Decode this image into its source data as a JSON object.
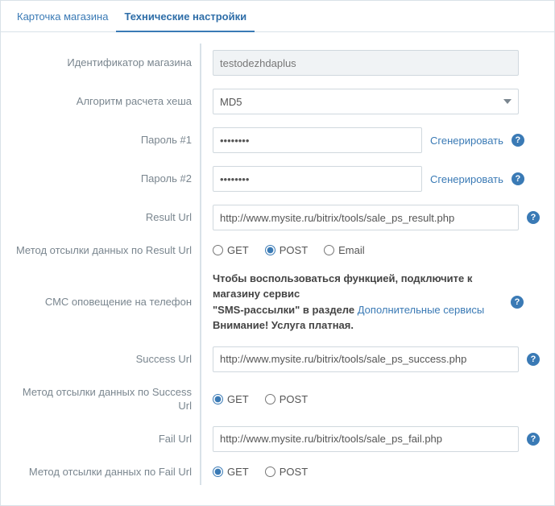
{
  "tabs": {
    "card": "Карточка магазина",
    "tech": "Технические настройки"
  },
  "labels": {
    "shop_id": "Идентификатор магазина",
    "hash_algo": "Алгоритм расчета хеша",
    "pass1": "Пароль #1",
    "pass2": "Пароль #2",
    "result_url": "Result Url",
    "result_method": "Метод отсылки данных по Result Url",
    "sms": "СМС оповещение на телефон",
    "success_url": "Success Url",
    "success_method": "Метод отсылки данных по Success Url",
    "fail_url": "Fail Url",
    "fail_method": "Метод отсылки данных по Fail Url"
  },
  "values": {
    "shop_id": "testodezhdaplus",
    "hash_algo": "MD5",
    "pass1": "••••••••",
    "pass2": "••••••••",
    "result_url": "http://www.mysite.ru/bitrix/tools/sale_ps_result.php",
    "success_url": "http://www.mysite.ru/bitrix/tools/sale_ps_success.php",
    "fail_url": "http://www.mysite.ru/bitrix/tools/sale_ps_fail.php"
  },
  "actions": {
    "generate": "Сгенерировать"
  },
  "options": {
    "get": "GET",
    "post": "POST",
    "email": "Email"
  },
  "sms": {
    "line1a": "Чтобы воспользоваться функцией, подключите к магазину сервис",
    "line2a": "\"SMS-рассылки\" в разделе ",
    "link": "Дополнительные сервисы",
    "line3": "Внимание! Услуга платная."
  },
  "help": "?"
}
